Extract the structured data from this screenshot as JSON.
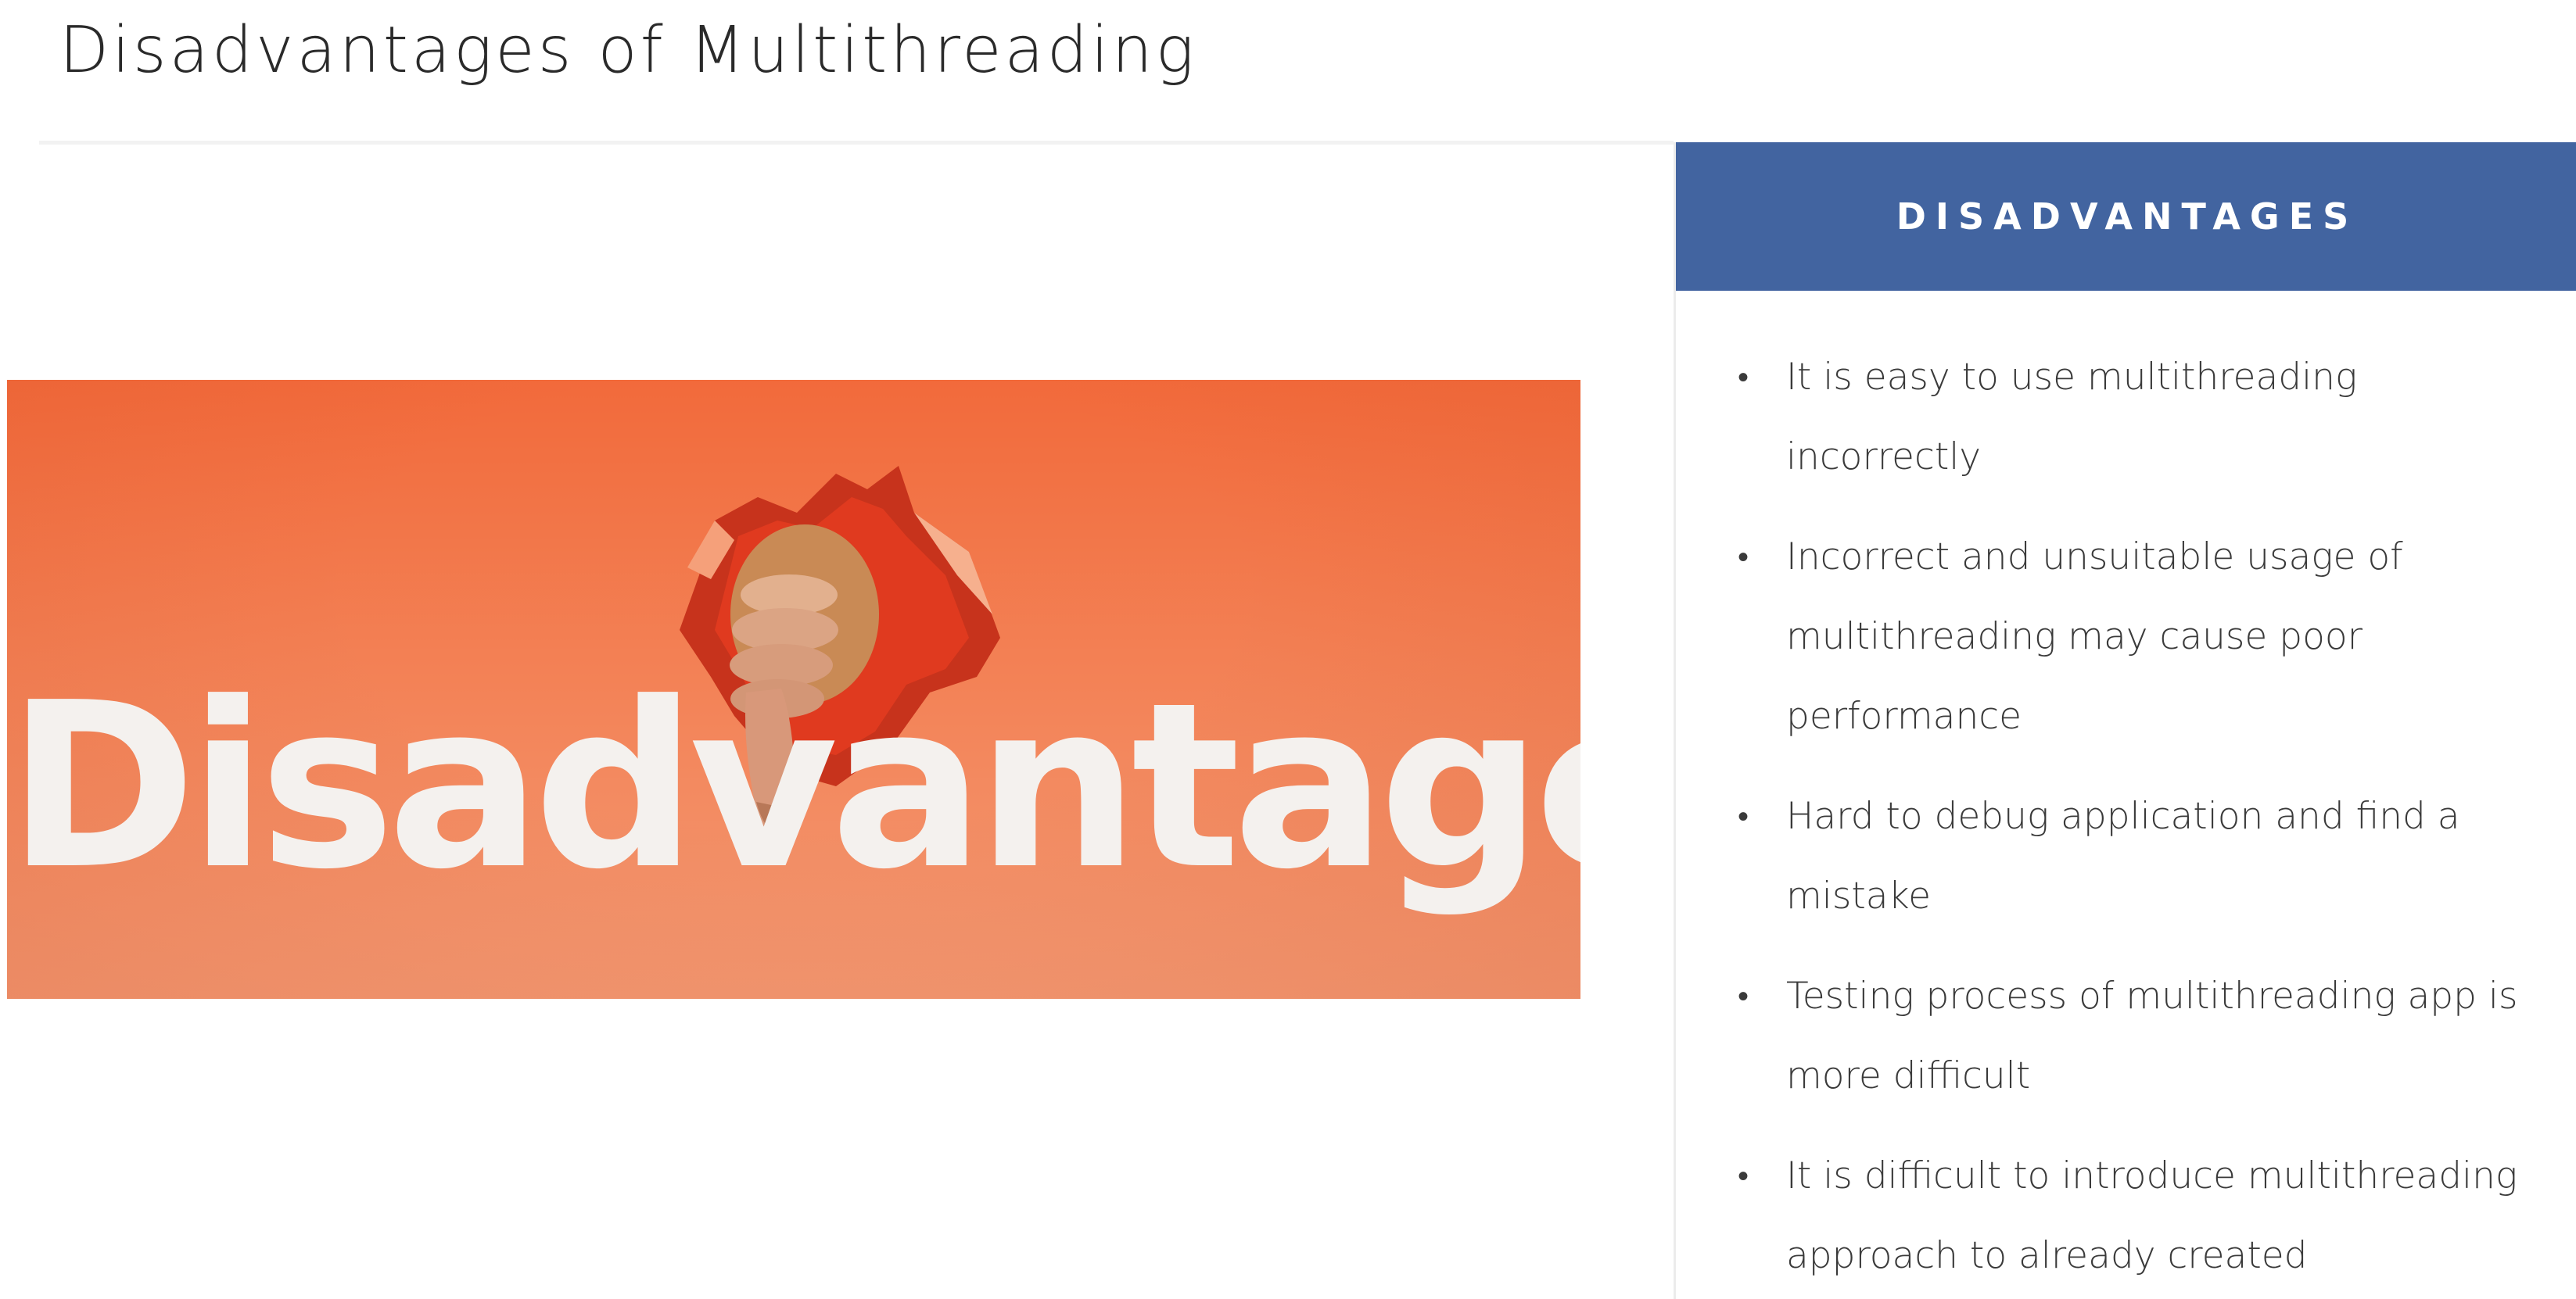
{
  "slide": {
    "title": "Disadvantages of Multithreading"
  },
  "image": {
    "text": "Disadvantages",
    "description_icon": "thumbs-down-through-paper-icon",
    "background_color": "#f3855a"
  },
  "panel": {
    "heading": "DISADVANTAGES",
    "header_color": "#4264a0",
    "bullets": [
      "It is easy to use multithreading incorrectly",
      "Incorrect and unsuitable usage of multithreading may cause poor performance",
      "Hard to debug application and find a mistake",
      "Testing process of multithreading app is more difficult",
      "It is difficult to introduce multithreading approach to already created"
    ]
  }
}
